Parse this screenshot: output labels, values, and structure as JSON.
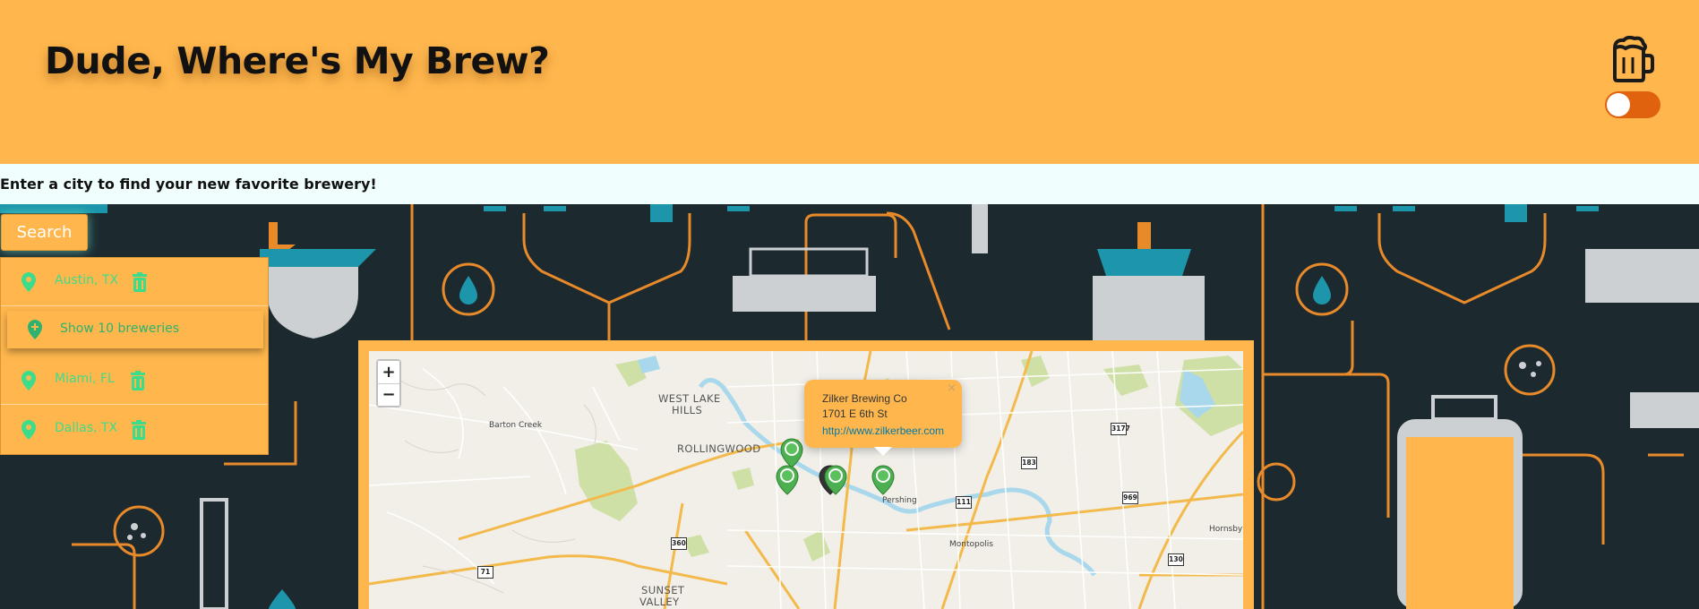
{
  "header": {
    "title": "Dude, Where's My Brew?",
    "theme_toggle": "on"
  },
  "intro": {
    "text": "Enter a city to find your new favorite brewery!"
  },
  "search": {
    "button_label": "Search"
  },
  "cities": [
    {
      "label": "Austin, TX"
    },
    {
      "label": "Miami, FL"
    },
    {
      "label": "Dallas, TX"
    }
  ],
  "show_breweries": {
    "label": "Show 10 breweries"
  },
  "map": {
    "zoom_in": "+",
    "zoom_out": "−",
    "places": {
      "west_lake_hills_1": "WEST LAKE",
      "west_lake_hills_2": "HILLS",
      "barton_creek": "Barton Creek",
      "rollingwood": "ROLLINGWOOD",
      "pershing": "Pershing",
      "montopolis": "Montopolis",
      "sunset_valley_1": "SUNSET",
      "sunset_valley_2": "VALLEY",
      "hornsby": "Hornsby"
    },
    "shields": {
      "s3177": "3177",
      "s183": "183",
      "s111": "111",
      "s969": "969",
      "s360": "360",
      "s71": "71",
      "s130": "130"
    },
    "popup": {
      "close": "×",
      "name": "Zilker Brewing Co",
      "address": "1701 E 6th St",
      "url": "http://www.zilkerbeer.com"
    }
  },
  "colors": {
    "accent": "#ffb74d",
    "marker": "#4caf50",
    "label_green": "#3ddc8b",
    "toggle": "#e0620f",
    "background": "#1c2a30"
  }
}
